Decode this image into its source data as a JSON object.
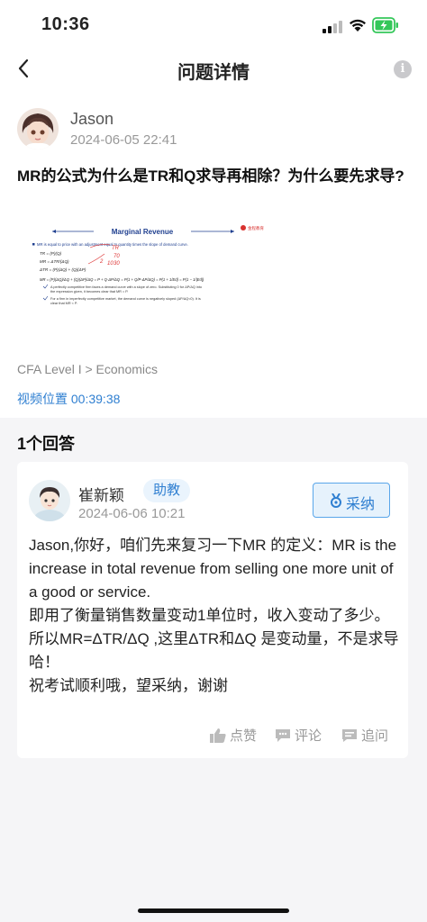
{
  "status_bar": {
    "time": "10:36"
  },
  "nav": {
    "title": "问题详情",
    "info_icon": "info-icon"
  },
  "question": {
    "author": "Jason",
    "datetime": "2024-06-05 22:41",
    "title": "MR的公式为什么是TR和Q求导再相除？为什么要先求导?",
    "slide": {
      "title": "Marginal Revenue",
      "logo_text": "金程教育",
      "bullet": "MR is equal to price with an adjustment equal to quantity times the slope of demand curve.",
      "formula1": "TR = (P)(Q)",
      "formula2": "MR = ΔTR/(ΔQ)",
      "formula3": "ΔTR = (P)(ΔQ) + (Q)(ΔP)",
      "formula4": "MR = (P)(ΔQ)/ΔQ + (Q)(ΔP)/ΔQ = P + Q·ΔP/ΔQ = P(1 + Q/P·ΔP/ΔQ) = P(1 + 1/Ed) = P(1 − 1/|Ed|)",
      "note1": "A perfectly competitive firm faces a demand curve with a slope of zero. Substituting 0 for ΔP/ΔQ into",
      "note1b": "the expression given, it becomes clear that MR = P.",
      "note2": "For a firm in imperfectly competitive market, the demand curve is negatively sloped (ΔP/ΔQ<0). It is",
      "note2b": "clear that MR < P.",
      "handwriting": [
        "TR",
        "70",
        "30",
        "2",
        "10"
      ]
    },
    "category": "CFA Level I > Economics",
    "video_position": "视频位置 00:39:38"
  },
  "answers_count_label": "1个回答",
  "answer": {
    "author": "崔新颖",
    "role_badge": "助教",
    "datetime": "2024-06-06 10:21",
    "adopt_label": "采纳",
    "lines": [
      "Jason,你好，咱们先来复习一下MR 的定义：MR is the increase in total revenue from selling one more unit of a good or service.",
      "即用了衡量销售数量变动1单位时，收入变动了多少。所以MR=ΔTR/ΔQ ,这里ΔTR和ΔQ 是变动量，不是求导哈！",
      "祝考试顺利哦，望采纳，谢谢"
    ],
    "actions": {
      "like": "点赞",
      "comment": "评论",
      "follow_up": "追问"
    }
  },
  "colors": {
    "accent": "#2f7fd1",
    "adopt_bg": "#e6f2fc",
    "badge_bg": "#eaf4fd",
    "battery": "#34c759"
  }
}
